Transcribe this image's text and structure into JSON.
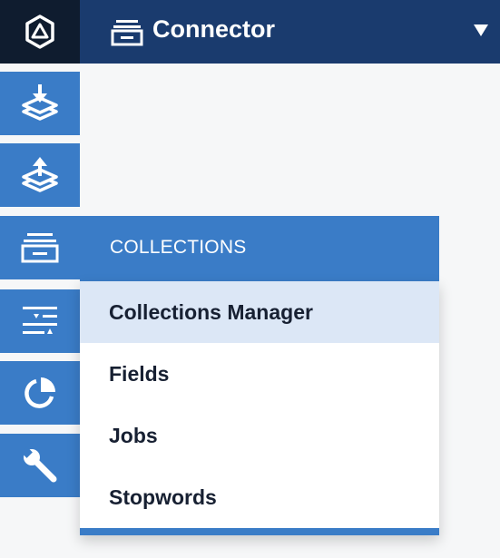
{
  "topbar": {
    "workspace_title": "Connector",
    "workspace_icon": "collections-stack-icon",
    "caret_icon": "caret-down-icon"
  },
  "logo": {
    "icon": "hexagon-triangle-logo"
  },
  "nav": {
    "items": [
      {
        "id": "import",
        "icon": "layers-download-icon"
      },
      {
        "id": "export",
        "icon": "layers-upload-icon"
      },
      {
        "id": "collections",
        "icon": "collections-stack-icon",
        "active": true
      },
      {
        "id": "rules",
        "icon": "sliders-icon"
      },
      {
        "id": "analytics",
        "icon": "pie-chart-icon"
      },
      {
        "id": "system",
        "icon": "wrench-icon"
      }
    ]
  },
  "flyout": {
    "header": "COLLECTIONS",
    "items": [
      {
        "label": "Collections Manager",
        "active": true
      },
      {
        "label": "Fields",
        "active": false
      },
      {
        "label": "Jobs",
        "active": false
      },
      {
        "label": "Stopwords",
        "active": false
      }
    ]
  },
  "colors": {
    "logo_bg": "#0f1c2f",
    "topbar_bg": "#1a3b6e",
    "nav_bg": "#3a7cc7",
    "menu_active_bg": "#dce7f6",
    "menu_text": "#172032",
    "page_bg": "#f6f7f8"
  }
}
